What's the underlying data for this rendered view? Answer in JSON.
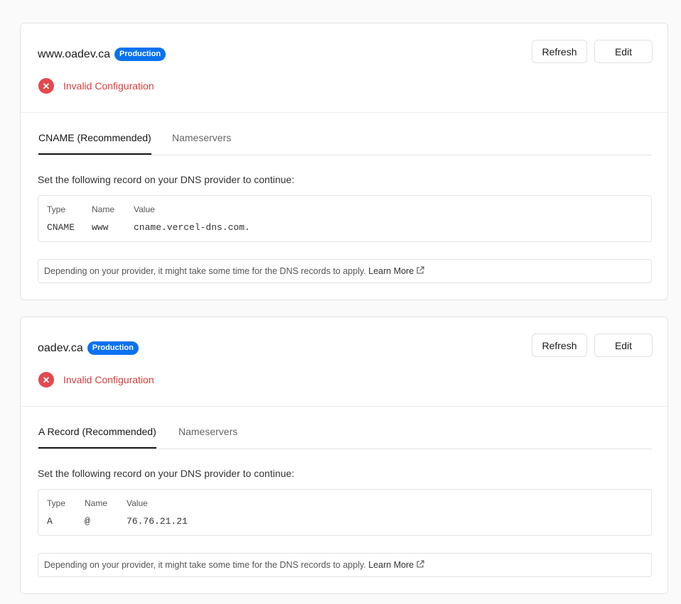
{
  "cards": [
    {
      "domain": "www.oadev.ca",
      "badge": "Production",
      "status": "Invalid Configuration",
      "buttons": {
        "refresh": "Refresh",
        "edit": "Edit"
      },
      "tabs": [
        "CNAME (Recommended)",
        "Nameservers"
      ],
      "instruction": "Set the following record on your DNS provider to continue:",
      "record": {
        "headers": [
          "Type",
          "Name",
          "Value"
        ],
        "values": [
          "CNAME",
          "www",
          "cname.vercel-dns.com."
        ]
      },
      "note": "Depending on your provider, it might take some time for the DNS records to apply.",
      "learn_more": "Learn More"
    },
    {
      "domain": "oadev.ca",
      "badge": "Production",
      "status": "Invalid Configuration",
      "buttons": {
        "refresh": "Refresh",
        "edit": "Edit"
      },
      "tabs": [
        "A Record (Recommended)",
        "Nameservers"
      ],
      "instruction": "Set the following record on your DNS provider to continue:",
      "record": {
        "headers": [
          "Type",
          "Name",
          "Value"
        ],
        "values": [
          "A",
          "@",
          "76.76.21.21"
        ]
      },
      "note": "Depending on your provider, it might take some time for the DNS records to apply.",
      "learn_more": "Learn More"
    }
  ],
  "colors": {
    "badge": "#0a72ef",
    "error": "#e5484d"
  },
  "icons": {
    "status": "x-circle-icon",
    "learn_more": "external-link-icon"
  }
}
